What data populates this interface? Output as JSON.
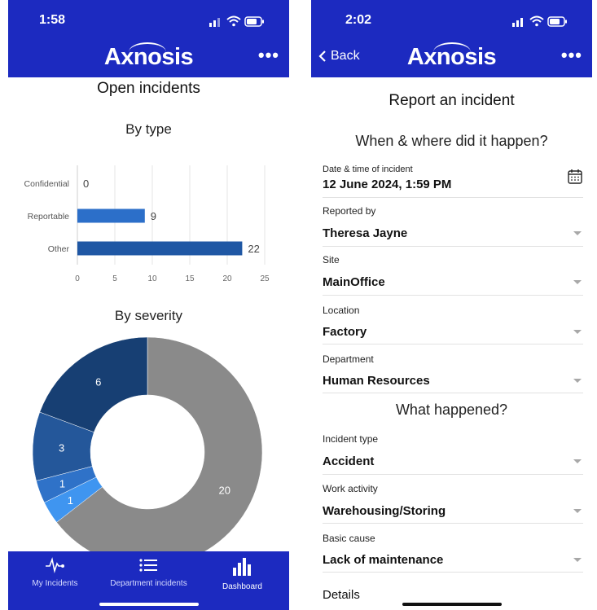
{
  "left": {
    "status_time": "1:58",
    "brand": "Axnosis",
    "page_title": "Open incidents",
    "by_type_title": "By type",
    "by_severity_title": "By severity",
    "tabs": [
      {
        "label": "My Incidents",
        "icon": "pulse-icon"
      },
      {
        "label": "Department incidents",
        "icon": "list-icon"
      },
      {
        "label": "Dashboard",
        "icon": "bar-chart-icon"
      }
    ]
  },
  "right": {
    "status_time": "2:02",
    "brand": "Axnosis",
    "back_label": "Back",
    "page_title": "Report an incident",
    "section_when": "When & where did it happen?",
    "section_what": "What happened?",
    "fields": [
      {
        "label": "Date & time of incident",
        "value": "12 June 2024, 1:59 PM"
      },
      {
        "label": "Reported by",
        "value": "Theresa Jayne"
      },
      {
        "label": "Site",
        "value": "MainOffice"
      },
      {
        "label": "Location",
        "value": "Factory"
      },
      {
        "label": "Department",
        "value": "Human Resources"
      },
      {
        "label": "Incident type",
        "value": "Accident"
      },
      {
        "label": "Work activity",
        "value": "Warehousing/Storing"
      },
      {
        "label": "Basic cause",
        "value": "Lack of maintenance"
      }
    ],
    "details_label": "Details"
  },
  "colors": {
    "header": "#1c2ac0",
    "bar_confidential": "#3f86d9",
    "bar_reportable": "#2c6fc9",
    "bar_other": "#1f57a4",
    "donut_gray": "#8a8a8a",
    "donut_navy": "#173f73",
    "donut_mid": "#24579a",
    "donut_blue": "#2f72c8",
    "donut_light": "#3f95f0"
  },
  "chart_data": [
    {
      "type": "bar",
      "orientation": "horizontal",
      "title": "By type",
      "categories": [
        "Confidential",
        "Reportable",
        "Other"
      ],
      "values": [
        0,
        9,
        22
      ],
      "xlim": [
        0,
        25
      ],
      "xticks": [
        0,
        5,
        10,
        15,
        20,
        25
      ],
      "grid": true
    },
    {
      "type": "pie",
      "style": "donut",
      "title": "By severity",
      "values": [
        20,
        1,
        1,
        3,
        6
      ],
      "colors": [
        "#8a8a8a",
        "#3f95f0",
        "#2f72c8",
        "#24579a",
        "#173f73"
      ]
    }
  ]
}
